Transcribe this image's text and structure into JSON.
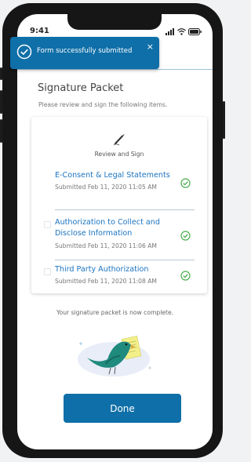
{
  "status_bar": {
    "time": "9:41",
    "icons": [
      "signal-icon",
      "wifi-icon",
      "battery-icon"
    ]
  },
  "toast": {
    "message": "Form successfully submitted",
    "icon": "check-circle-icon",
    "close_glyph": "×"
  },
  "page": {
    "title": "Signature Packet",
    "subtitle": "Please review and sign the following items."
  },
  "card": {
    "heading": "Review and Sign",
    "heading_icon": "pen-icon",
    "items": [
      {
        "title_lines": [
          "E-Consent & Legal Statements"
        ],
        "submitted": "Submitted Feb 11, 2020   11:05 AM",
        "status_icon": "check-circle-icon"
      },
      {
        "title_lines": [
          "Authorization to Collect and",
          "Disclose Information"
        ],
        "submitted": "Submitted Feb 11, 2020   11:06 AM",
        "status_icon": "check-circle-icon"
      },
      {
        "title_lines": [
          "Third Party Authorization"
        ],
        "submitted": "Submitted Feb 11, 2020   11:08 AM",
        "status_icon": "check-circle-icon"
      }
    ]
  },
  "completion": {
    "message": "Your signature packet is now complete.",
    "illustration": "bird-with-document-illustration"
  },
  "done_button": {
    "label": "Done"
  },
  "colors": {
    "primary": "#0f6fa8",
    "link": "#1b74c0",
    "success": "#4caf50",
    "bird": "#1f8a7e",
    "note": "#f3f08a"
  }
}
